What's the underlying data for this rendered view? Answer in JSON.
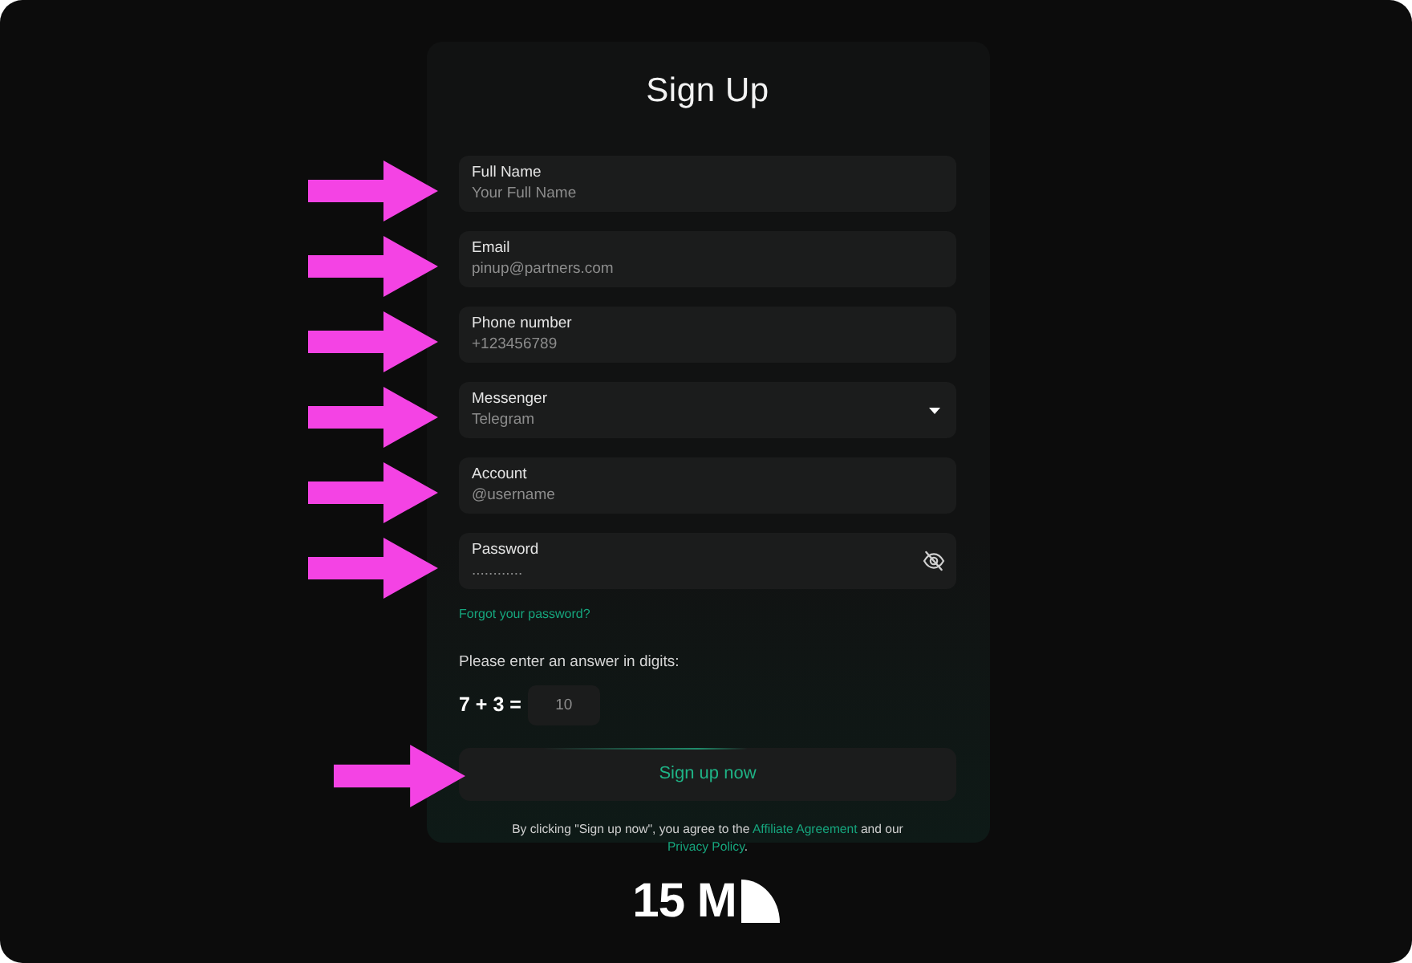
{
  "title": "Sign Up",
  "fields": [
    {
      "kind": "text",
      "label": "Full Name",
      "placeholder": "Your Full Name",
      "arrow": true
    },
    {
      "kind": "text",
      "label": "Email",
      "placeholder": "pinup@partners.com",
      "arrow": true
    },
    {
      "kind": "text",
      "label": "Phone number",
      "placeholder": "+123456789",
      "arrow": true
    },
    {
      "kind": "select",
      "label": "Messenger",
      "value": "Telegram",
      "arrow": true
    },
    {
      "kind": "text",
      "label": "Account",
      "placeholder": "@username",
      "arrow": true
    },
    {
      "kind": "password",
      "label": "Password",
      "placeholder": "............",
      "arrow": true
    }
  ],
  "forgot_link": "Forgot your password?",
  "captcha": {
    "prompt": "Please enter an answer in digits:",
    "question": "7 + 3 =",
    "placeholder": "10"
  },
  "submit": {
    "label": "Sign up now",
    "arrow": true
  },
  "terms": [
    {
      "kind": "text",
      "text": "By clicking \"Sign up now\", you agree to the "
    },
    {
      "kind": "link",
      "text": "Affiliate Agreement"
    },
    {
      "kind": "text",
      "text": " and our "
    },
    {
      "kind": "link",
      "text": "Privacy Policy"
    },
    {
      "kind": "text",
      "text": "."
    }
  ],
  "logo": {
    "text": "15 M"
  }
}
